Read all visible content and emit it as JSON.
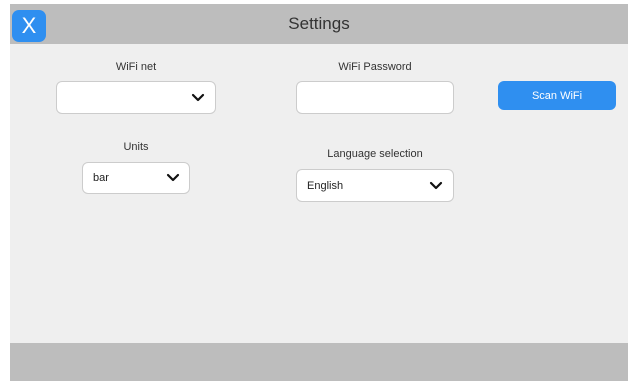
{
  "header": {
    "title": "Settings",
    "close_label": "X"
  },
  "wifi": {
    "net_label": "WiFi net",
    "net_value": "",
    "password_label": "WiFi Password",
    "password_value": "",
    "scan_label": "Scan WiFi"
  },
  "units": {
    "label": "Units",
    "value": "bar"
  },
  "language": {
    "label": "Language selection",
    "value": "English"
  },
  "colors": {
    "accent": "#2f8ff0",
    "header_bg": "#bdbdbd",
    "content_bg": "#efefef"
  },
  "icons": {
    "dropdown": "chevron-down-icon"
  }
}
